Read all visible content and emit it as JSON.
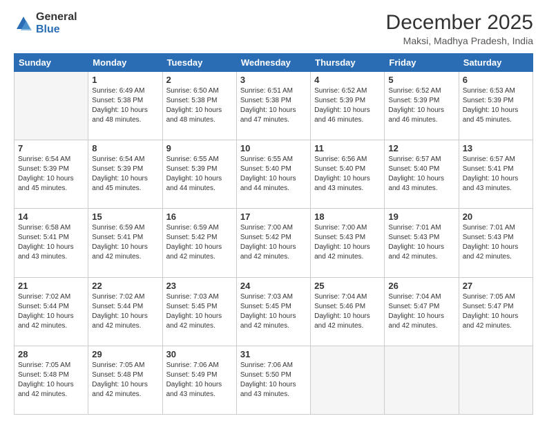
{
  "logo": {
    "general": "General",
    "blue": "Blue"
  },
  "title": "December 2025",
  "location": "Maksi, Madhya Pradesh, India",
  "days_header": [
    "Sunday",
    "Monday",
    "Tuesday",
    "Wednesday",
    "Thursday",
    "Friday",
    "Saturday"
  ],
  "weeks": [
    [
      {
        "day": "",
        "info": ""
      },
      {
        "day": "1",
        "info": "Sunrise: 6:49 AM\nSunset: 5:38 PM\nDaylight: 10 hours\nand 48 minutes."
      },
      {
        "day": "2",
        "info": "Sunrise: 6:50 AM\nSunset: 5:38 PM\nDaylight: 10 hours\nand 48 minutes."
      },
      {
        "day": "3",
        "info": "Sunrise: 6:51 AM\nSunset: 5:38 PM\nDaylight: 10 hours\nand 47 minutes."
      },
      {
        "day": "4",
        "info": "Sunrise: 6:52 AM\nSunset: 5:39 PM\nDaylight: 10 hours\nand 46 minutes."
      },
      {
        "day": "5",
        "info": "Sunrise: 6:52 AM\nSunset: 5:39 PM\nDaylight: 10 hours\nand 46 minutes."
      },
      {
        "day": "6",
        "info": "Sunrise: 6:53 AM\nSunset: 5:39 PM\nDaylight: 10 hours\nand 45 minutes."
      }
    ],
    [
      {
        "day": "7",
        "info": "Sunrise: 6:54 AM\nSunset: 5:39 PM\nDaylight: 10 hours\nand 45 minutes."
      },
      {
        "day": "8",
        "info": "Sunrise: 6:54 AM\nSunset: 5:39 PM\nDaylight: 10 hours\nand 45 minutes."
      },
      {
        "day": "9",
        "info": "Sunrise: 6:55 AM\nSunset: 5:39 PM\nDaylight: 10 hours\nand 44 minutes."
      },
      {
        "day": "10",
        "info": "Sunrise: 6:55 AM\nSunset: 5:40 PM\nDaylight: 10 hours\nand 44 minutes."
      },
      {
        "day": "11",
        "info": "Sunrise: 6:56 AM\nSunset: 5:40 PM\nDaylight: 10 hours\nand 43 minutes."
      },
      {
        "day": "12",
        "info": "Sunrise: 6:57 AM\nSunset: 5:40 PM\nDaylight: 10 hours\nand 43 minutes."
      },
      {
        "day": "13",
        "info": "Sunrise: 6:57 AM\nSunset: 5:41 PM\nDaylight: 10 hours\nand 43 minutes."
      }
    ],
    [
      {
        "day": "14",
        "info": "Sunrise: 6:58 AM\nSunset: 5:41 PM\nDaylight: 10 hours\nand 43 minutes."
      },
      {
        "day": "15",
        "info": "Sunrise: 6:59 AM\nSunset: 5:41 PM\nDaylight: 10 hours\nand 42 minutes."
      },
      {
        "day": "16",
        "info": "Sunrise: 6:59 AM\nSunset: 5:42 PM\nDaylight: 10 hours\nand 42 minutes."
      },
      {
        "day": "17",
        "info": "Sunrise: 7:00 AM\nSunset: 5:42 PM\nDaylight: 10 hours\nand 42 minutes."
      },
      {
        "day": "18",
        "info": "Sunrise: 7:00 AM\nSunset: 5:43 PM\nDaylight: 10 hours\nand 42 minutes."
      },
      {
        "day": "19",
        "info": "Sunrise: 7:01 AM\nSunset: 5:43 PM\nDaylight: 10 hours\nand 42 minutes."
      },
      {
        "day": "20",
        "info": "Sunrise: 7:01 AM\nSunset: 5:43 PM\nDaylight: 10 hours\nand 42 minutes."
      }
    ],
    [
      {
        "day": "21",
        "info": "Sunrise: 7:02 AM\nSunset: 5:44 PM\nDaylight: 10 hours\nand 42 minutes."
      },
      {
        "day": "22",
        "info": "Sunrise: 7:02 AM\nSunset: 5:44 PM\nDaylight: 10 hours\nand 42 minutes."
      },
      {
        "day": "23",
        "info": "Sunrise: 7:03 AM\nSunset: 5:45 PM\nDaylight: 10 hours\nand 42 minutes."
      },
      {
        "day": "24",
        "info": "Sunrise: 7:03 AM\nSunset: 5:45 PM\nDaylight: 10 hours\nand 42 minutes."
      },
      {
        "day": "25",
        "info": "Sunrise: 7:04 AM\nSunset: 5:46 PM\nDaylight: 10 hours\nand 42 minutes."
      },
      {
        "day": "26",
        "info": "Sunrise: 7:04 AM\nSunset: 5:47 PM\nDaylight: 10 hours\nand 42 minutes."
      },
      {
        "day": "27",
        "info": "Sunrise: 7:05 AM\nSunset: 5:47 PM\nDaylight: 10 hours\nand 42 minutes."
      }
    ],
    [
      {
        "day": "28",
        "info": "Sunrise: 7:05 AM\nSunset: 5:48 PM\nDaylight: 10 hours\nand 42 minutes."
      },
      {
        "day": "29",
        "info": "Sunrise: 7:05 AM\nSunset: 5:48 PM\nDaylight: 10 hours\nand 42 minutes."
      },
      {
        "day": "30",
        "info": "Sunrise: 7:06 AM\nSunset: 5:49 PM\nDaylight: 10 hours\nand 43 minutes."
      },
      {
        "day": "31",
        "info": "Sunrise: 7:06 AM\nSunset: 5:50 PM\nDaylight: 10 hours\nand 43 minutes."
      },
      {
        "day": "",
        "info": ""
      },
      {
        "day": "",
        "info": ""
      },
      {
        "day": "",
        "info": ""
      }
    ]
  ]
}
